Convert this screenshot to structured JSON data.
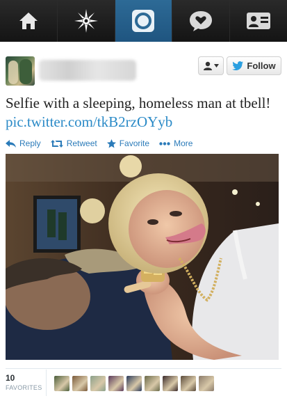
{
  "nav": {
    "items": [
      {
        "name": "home",
        "icon": "home-icon",
        "active": false
      },
      {
        "name": "connect",
        "icon": "connect-star-icon",
        "active": false
      },
      {
        "name": "discover",
        "icon": "discover-circle-icon",
        "active": true
      },
      {
        "name": "messages",
        "icon": "speech-heart-icon",
        "active": false
      },
      {
        "name": "me",
        "icon": "profile-card-icon",
        "active": false
      }
    ],
    "colors": {
      "bar": "#1a1a1a",
      "active": "#2d6a96",
      "icon": "#ffffff"
    }
  },
  "header": {
    "follow_label": "Follow"
  },
  "tweet": {
    "text": "Selfie with a sleeping, homeless man at tbell! ",
    "link": "pic.twitter.com/tkB2rzOYyb"
  },
  "actions": {
    "reply": "Reply",
    "retweet": "Retweet",
    "favorite": "Favorite",
    "more": "More",
    "color": "#2b7bb9"
  },
  "favorites": {
    "count": "10",
    "label": "FAVORITES",
    "avatar_colors": [
      "#4a5d3a",
      "#7a5a3a",
      "#8aa08a",
      "#5a3a5a",
      "#2a3a5a",
      "#6a6a4a",
      "#3a2a2a",
      "#5a4a3a",
      "#8a7a6a"
    ]
  }
}
